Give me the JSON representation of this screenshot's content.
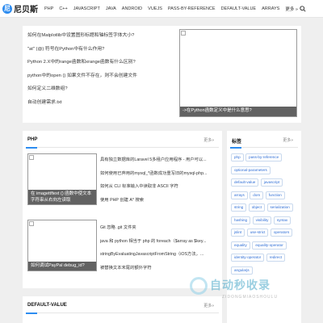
{
  "brand": {
    "logo_mark": "尼",
    "name": "尼贝斯"
  },
  "nav": {
    "items": [
      "PHP",
      "C++",
      "JAVASCRIPT",
      "JAVA",
      "ANDROID",
      "VUEJS",
      "PASS-BY-REFERENCE",
      "DEFAULT-VALUE",
      "ARRAYS"
    ],
    "more_label": "更多",
    "more_arrow": "»"
  },
  "section_a": {
    "items": [
      "如何在Matplotlib中设置图形标题和轴标签字体大小?",
      "\"at\" (@) 符号在Python中有什么作用?",
      "Python 2.X中的range函数和xrange函数有什么区别?",
      "python中的open () 如果文件不存在，则不会创建文件",
      "如何定义二维数组?",
      "自动创建需求.txt"
    ],
    "thumb_caption": "->在Python函数定义中是什么意思?"
  },
  "php": {
    "title": "PHP",
    "more": "更多»",
    "thumb1_caption": "在 imagettftext () 函数中使文本字符串从右向左读取",
    "thumb2_caption": "如何调试PayPal debug_id?",
    "list1": [
      "具有独立数据库的Laravel 5多租户应用程序 - 用户可以...",
      "如何使用已弃用的mysql_*函数成功重写旧的mysql-php...",
      "如何从 CLI 标准输入中读取非 ASCII 字符",
      "使用 PHP 创建 A* 搜索"
    ],
    "list2": [
      "Git 忽略 .git 文件夹",
      "java 和 python 相当于 php 的 foreach（$array as $key...",
      "stringByEvaluatingJavascriptFromString（iOS方法，...",
      "被替换文本末尾的额外字符"
    ]
  },
  "tags": {
    "title": "标签",
    "more": "更多»",
    "items": [
      "php",
      "pass-by-reference",
      "optional-parameters",
      "default-value",
      "javascript",
      "arrays",
      "dom",
      "function",
      "string",
      "object",
      "serialization",
      "hashing",
      "visibility",
      "syntax",
      "jslint",
      "use-strict",
      "operators",
      "equality",
      "equality-operator",
      "identity-operator",
      "redirect",
      "angularjs"
    ]
  },
  "default_value": {
    "title": "DEFAULT-VALUE",
    "more": "更多»"
  },
  "watermark": {
    "text": "自动秒收录",
    "sub": "ZIDONGMIAOSHOULU"
  },
  "colors": {
    "accent": "#2d8cf0",
    "tag_text": "#2d6dd6",
    "tag_border": "#c9d9ee"
  }
}
